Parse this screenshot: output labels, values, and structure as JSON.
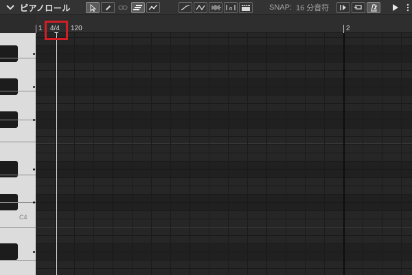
{
  "toolbar": {
    "title": "ピアノロール",
    "collapse_icon": "chevron-down-icon",
    "tool_buttons": [
      {
        "icon": "pointer-icon",
        "active": true
      },
      {
        "icon": "pencil-icon",
        "active": false
      },
      {
        "icon": "link-icon",
        "active": false,
        "disabled": true
      },
      {
        "icon": "velocity-bars-icon",
        "active": true
      },
      {
        "icon": "automation-curve-icon",
        "active": false
      }
    ],
    "view_buttons": [
      {
        "icon": "curve-smooth-icon"
      },
      {
        "icon": "curve-zigzag-icon"
      },
      {
        "icon": "waveform-icon"
      },
      {
        "icon": "bracket-text-icon"
      },
      {
        "icon": "clapperboard-icon"
      }
    ],
    "snap_label": "SNAP:",
    "snap_value": "16 分音符",
    "transport_buttons": [
      {
        "icon": "step-input-icon"
      },
      {
        "icon": "loop-icon"
      },
      {
        "icon": "metronome-icon"
      }
    ],
    "play_icon": "play-icon"
  },
  "ruler": {
    "bar_start": "1",
    "time_signature": "4/4",
    "tempo": "120",
    "bar_2": "2"
  },
  "keyboard": {
    "c4_label": "C4"
  },
  "colors": {
    "highlight": "#d21f25",
    "background": "#262626",
    "toolbar": "#333333"
  }
}
